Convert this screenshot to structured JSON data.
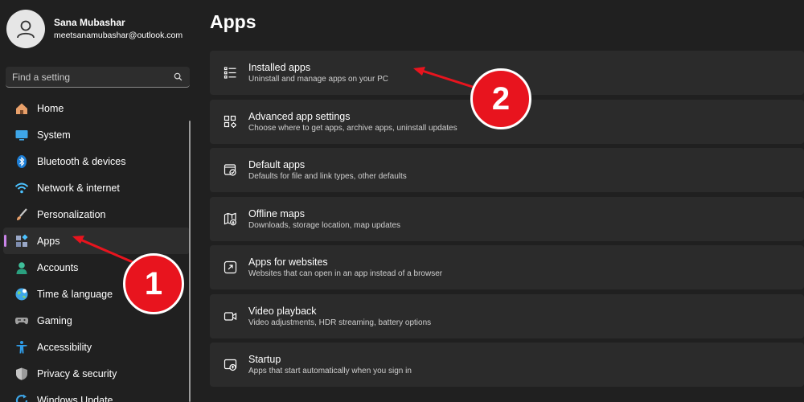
{
  "profile": {
    "name": "Sana Mubashar",
    "email": "meetsanamubashar@outlook.com"
  },
  "search": {
    "placeholder": "Find a setting"
  },
  "sidebar": {
    "items": [
      {
        "label": "Home",
        "icon": "home-icon"
      },
      {
        "label": "System",
        "icon": "system-icon"
      },
      {
        "label": "Bluetooth & devices",
        "icon": "bluetooth-icon"
      },
      {
        "label": "Network & internet",
        "icon": "wifi-icon"
      },
      {
        "label": "Personalization",
        "icon": "brush-icon"
      },
      {
        "label": "Apps",
        "icon": "apps-icon",
        "active": true
      },
      {
        "label": "Accounts",
        "icon": "accounts-icon"
      },
      {
        "label": "Time & language",
        "icon": "globe-icon"
      },
      {
        "label": "Gaming",
        "icon": "gamepad-icon"
      },
      {
        "label": "Accessibility",
        "icon": "accessibility-icon"
      },
      {
        "label": "Privacy & security",
        "icon": "shield-icon"
      },
      {
        "label": "Windows Update",
        "icon": "update-icon"
      }
    ]
  },
  "main": {
    "title": "Apps",
    "cards": [
      {
        "title": "Installed apps",
        "subtitle": "Uninstall and manage apps on your PC",
        "icon": "list-icon"
      },
      {
        "title": "Advanced app settings",
        "subtitle": "Choose where to get apps, archive apps, uninstall updates",
        "icon": "app-settings-icon"
      },
      {
        "title": "Default apps",
        "subtitle": "Defaults for file and link types, other defaults",
        "icon": "default-apps-icon"
      },
      {
        "title": "Offline maps",
        "subtitle": "Downloads, storage location, map updates",
        "icon": "map-icon"
      },
      {
        "title": "Apps for websites",
        "subtitle": "Websites that can open in an app instead of a browser",
        "icon": "open-in-app-icon"
      },
      {
        "title": "Video playback",
        "subtitle": "Video adjustments, HDR streaming, battery options",
        "icon": "video-icon"
      },
      {
        "title": "Startup",
        "subtitle": "Apps that start automatically when you sign in",
        "icon": "startup-icon"
      }
    ]
  },
  "annotations": {
    "badge_1": "1",
    "badge_2": "2",
    "accent": "#e8141e"
  },
  "colors": {
    "background": "#202020",
    "card": "#2b2b2b",
    "active_indicator": "#c984e8"
  }
}
